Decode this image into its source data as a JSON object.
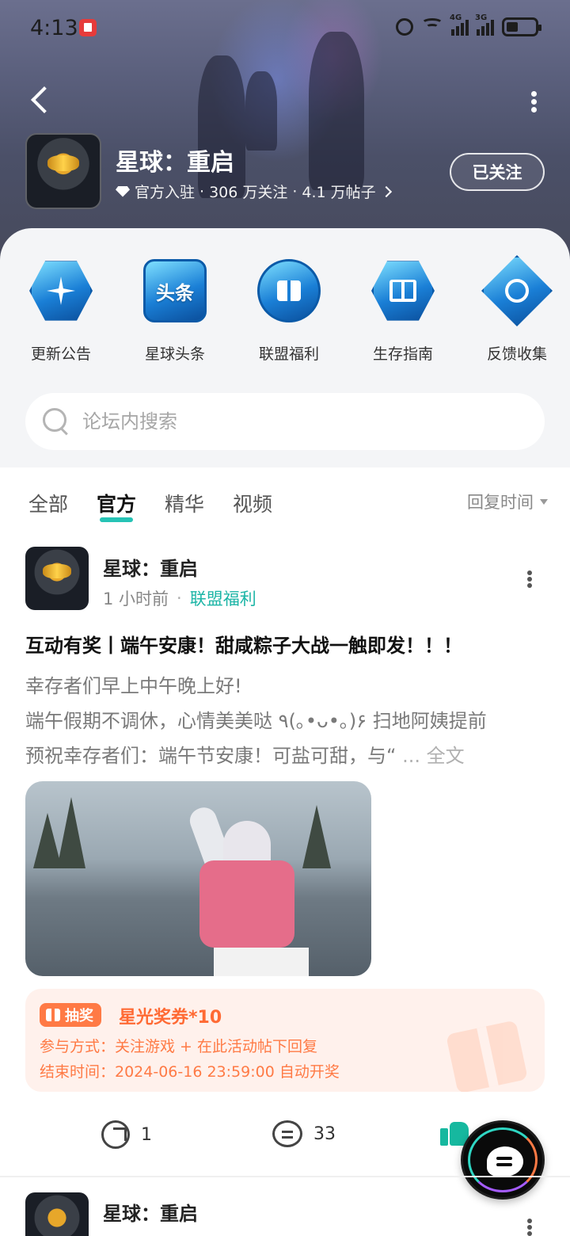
{
  "status_bar": {
    "time": "4:13",
    "net1": "4G",
    "net2": "3G"
  },
  "header": {
    "game_name": "星球：重启",
    "official_label": "官方入驻",
    "followers": "306 万关注",
    "posts": "4.1 万帖子",
    "separator": "·",
    "follow_button": "已关注"
  },
  "quick_links": [
    {
      "label": "更新公告",
      "icon": "compass-star-icon"
    },
    {
      "label": "星球头条",
      "icon": "headline-icon",
      "glyph": "头条"
    },
    {
      "label": "联盟福利",
      "icon": "gift-icon"
    },
    {
      "label": "生存指南",
      "icon": "book-icon"
    },
    {
      "label": "反馈收集",
      "icon": "medal-icon"
    }
  ],
  "search": {
    "placeholder": "论坛内搜索"
  },
  "tabs": {
    "items": [
      "全部",
      "官方",
      "精华",
      "视频"
    ],
    "active": "官方",
    "sort_label": "回复时间"
  },
  "post": {
    "author": "星球：重启",
    "time": "1 小时前",
    "dot": "·",
    "category": "联盟福利",
    "title": "互动有奖丨端午安康！甜咸粽子大战一触即发！！！",
    "body_lines": [
      "幸存者们早上中午晚上好!",
      "端午假期不调休，心情美美哒 ٩(｡•ᴗ•｡)۶ 扫地阿姨提前",
      "预祝幸存者们：端午节安康！可盐可甜，与“"
    ],
    "ellipsis": "...",
    "full_text": "全文",
    "lottery": {
      "badge": "抽奖",
      "prize": "星光奖券*10",
      "method": "参与方式：关注游戏 + 在此活动帖下回复",
      "end_time": "结束时间：2024-06-16 23:59:00 自动开奖"
    },
    "share_count": "1",
    "comment_count": "33"
  },
  "post2": {
    "author": "星球：重启"
  },
  "colors": {
    "accent": "#26c3b5",
    "category": "#1cb5a6",
    "lottery_orange": "#ff7a45",
    "like_green": "#16b89f"
  }
}
